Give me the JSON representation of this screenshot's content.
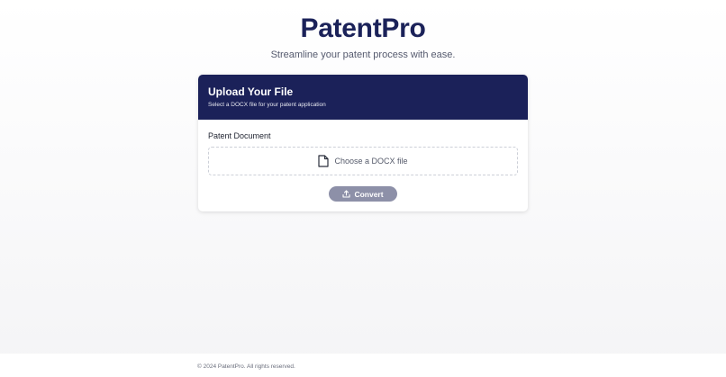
{
  "header": {
    "app_title": "PatentPro",
    "tagline": "Streamline your patent process with ease."
  },
  "upload_card": {
    "title": "Upload Your File",
    "subtitle": "Select a DOCX file for your patent application",
    "field_label": "Patent Document",
    "file_input_label": "Choose a DOCX file",
    "file_icon": "file-icon",
    "convert_label": "Convert",
    "convert_icon": "upload-icon"
  },
  "footer": {
    "copyright": "© 2024 PatentPro. All rights reserved."
  },
  "colors": {
    "brand_navy": "#1b2159",
    "button_disabled": "#8d90a8",
    "background": "#f4f4f6"
  }
}
